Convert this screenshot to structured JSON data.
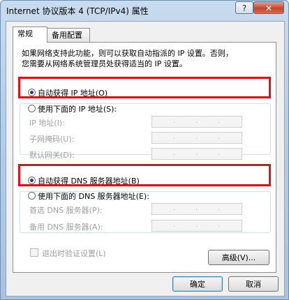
{
  "window": {
    "title": "Internet 协议版本 4 (TCP/IPv4) 属性",
    "help_glyph": "?",
    "close_glyph": "✕"
  },
  "tabs": [
    {
      "label": "常规"
    },
    {
      "label": "备用配置"
    }
  ],
  "description": [
    "如果网络支持此功能，则可以获取自动指派的 IP 设置。否则，",
    "您需要从网络系统管理员处获得适当的 IP 设置。"
  ],
  "ip": {
    "auto_label": "自动获得 IP 地址(O)",
    "manual_label": "使用下面的 IP 地址(S):",
    "fields": [
      {
        "label": "IP 地址(I):"
      },
      {
        "label": "子网掩码(U):"
      },
      {
        "label": "默认网关(D):"
      }
    ]
  },
  "dns": {
    "auto_label": "自动获得 DNS 服务器地址(B)",
    "manual_label": "使用下面的 DNS 服务器地址(E):",
    "fields": [
      {
        "label": "首选 DNS 服务器(P):"
      },
      {
        "label": "备用 DNS 服务器(A):"
      }
    ]
  },
  "ip_dot": ".",
  "validate_label": "退出时验证设置(L)",
  "buttons": {
    "advanced": "高级(V)...",
    "ok": "确定",
    "cancel": "取消"
  },
  "colors": {
    "highlight": "#d9141a",
    "title_gradient": "#b7cde6"
  }
}
